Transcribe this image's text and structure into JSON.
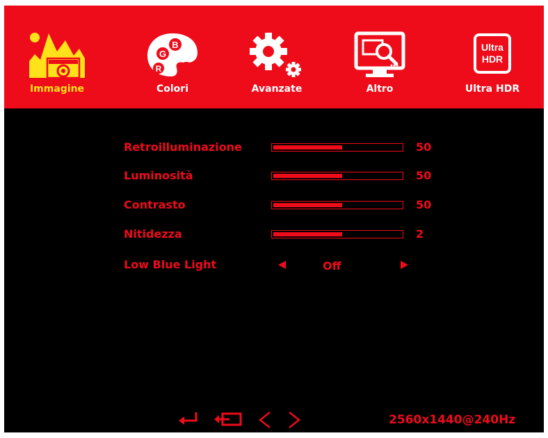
{
  "tabs": [
    {
      "label": "Immagine",
      "icon": "picture-mountain-icon",
      "active": true
    },
    {
      "label": "Colori",
      "icon": "color-palette-icon",
      "active": false
    },
    {
      "label": "Avanzate",
      "icon": "gears-icon",
      "active": false
    },
    {
      "label": "Altro",
      "icon": "monitor-search-icon",
      "active": false
    },
    {
      "label": "Ultra HDR",
      "icon": "ultra-hdr-icon",
      "active": false
    }
  ],
  "icon_text": {
    "palette_b": "B",
    "palette_g": "G",
    "palette_r": "R",
    "hdr_line1": "Ultra",
    "hdr_line2": "HDR"
  },
  "settings": [
    {
      "label": "Retroilluminazione",
      "value": "50",
      "level": 0.55
    },
    {
      "label": "Luminosità",
      "value": "50",
      "level": 0.55
    },
    {
      "label": "Contrasto",
      "value": "50",
      "level": 0.55
    },
    {
      "label": "Nitidezza",
      "value": "2",
      "level": 0.55
    }
  ],
  "low_blue_light": {
    "label": "Low Blue Light",
    "value": "Off"
  },
  "footer": {
    "keys": [
      "enter-icon",
      "exit-icon",
      "chevron-left-icon",
      "chevron-right-icon"
    ],
    "resolution": "2560x1440@240Hz"
  },
  "colors": {
    "accent": "#ee0b1a",
    "active_tab": "#ffe21a",
    "background": "#000000"
  }
}
